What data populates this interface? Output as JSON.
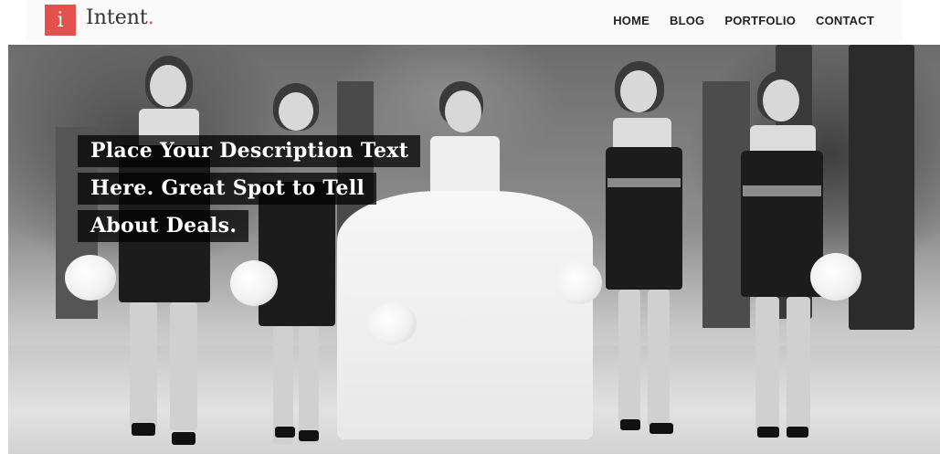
{
  "logo": {
    "mark": "i",
    "name": "Intent",
    "dot": "."
  },
  "nav": {
    "items": [
      "HOME",
      "BLOG",
      "PORTFOLIO",
      "CONTACT"
    ]
  },
  "hero": {
    "caption_lines": [
      "Place Your Description Text",
      "Here. Great Spot to Tell",
      "About Deals."
    ]
  },
  "colors": {
    "accent": "#e4504d",
    "caption_bg": "rgba(0,0,0,0.74)"
  }
}
